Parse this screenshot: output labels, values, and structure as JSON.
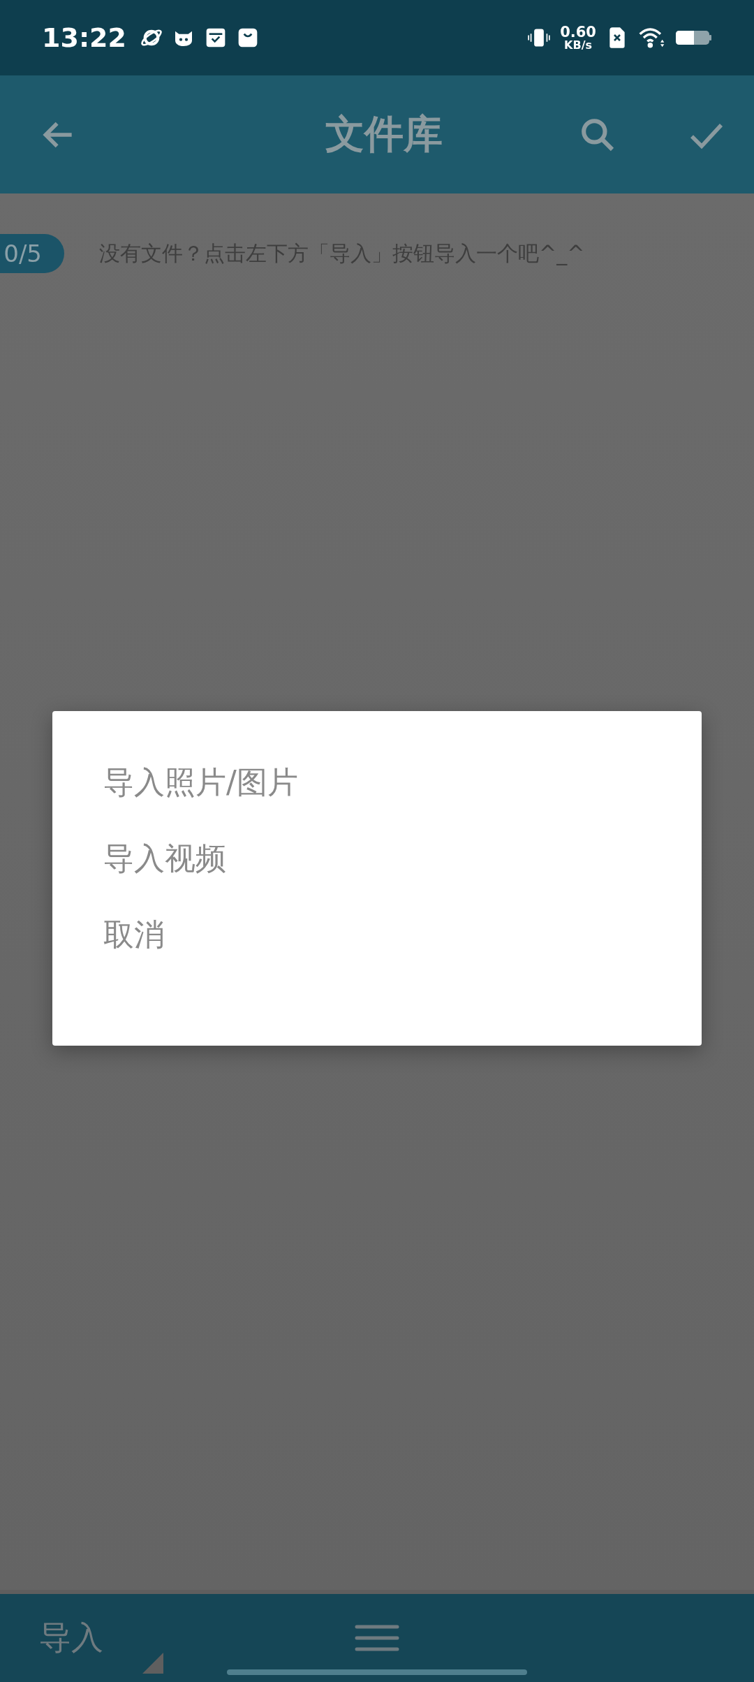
{
  "status_bar": {
    "time": "13:22",
    "speed_value": "0.60",
    "speed_unit": "KB/s"
  },
  "app_bar": {
    "title": "文件库"
  },
  "content": {
    "counter": "0/5",
    "empty_message": "没有文件？点击左下方「导入」按钮导入一个吧^_^"
  },
  "dialog": {
    "items": [
      {
        "label": "导入照片/图片"
      },
      {
        "label": "导入视频"
      },
      {
        "label": "取消"
      }
    ]
  },
  "bottom_bar": {
    "import_label": "导入"
  }
}
